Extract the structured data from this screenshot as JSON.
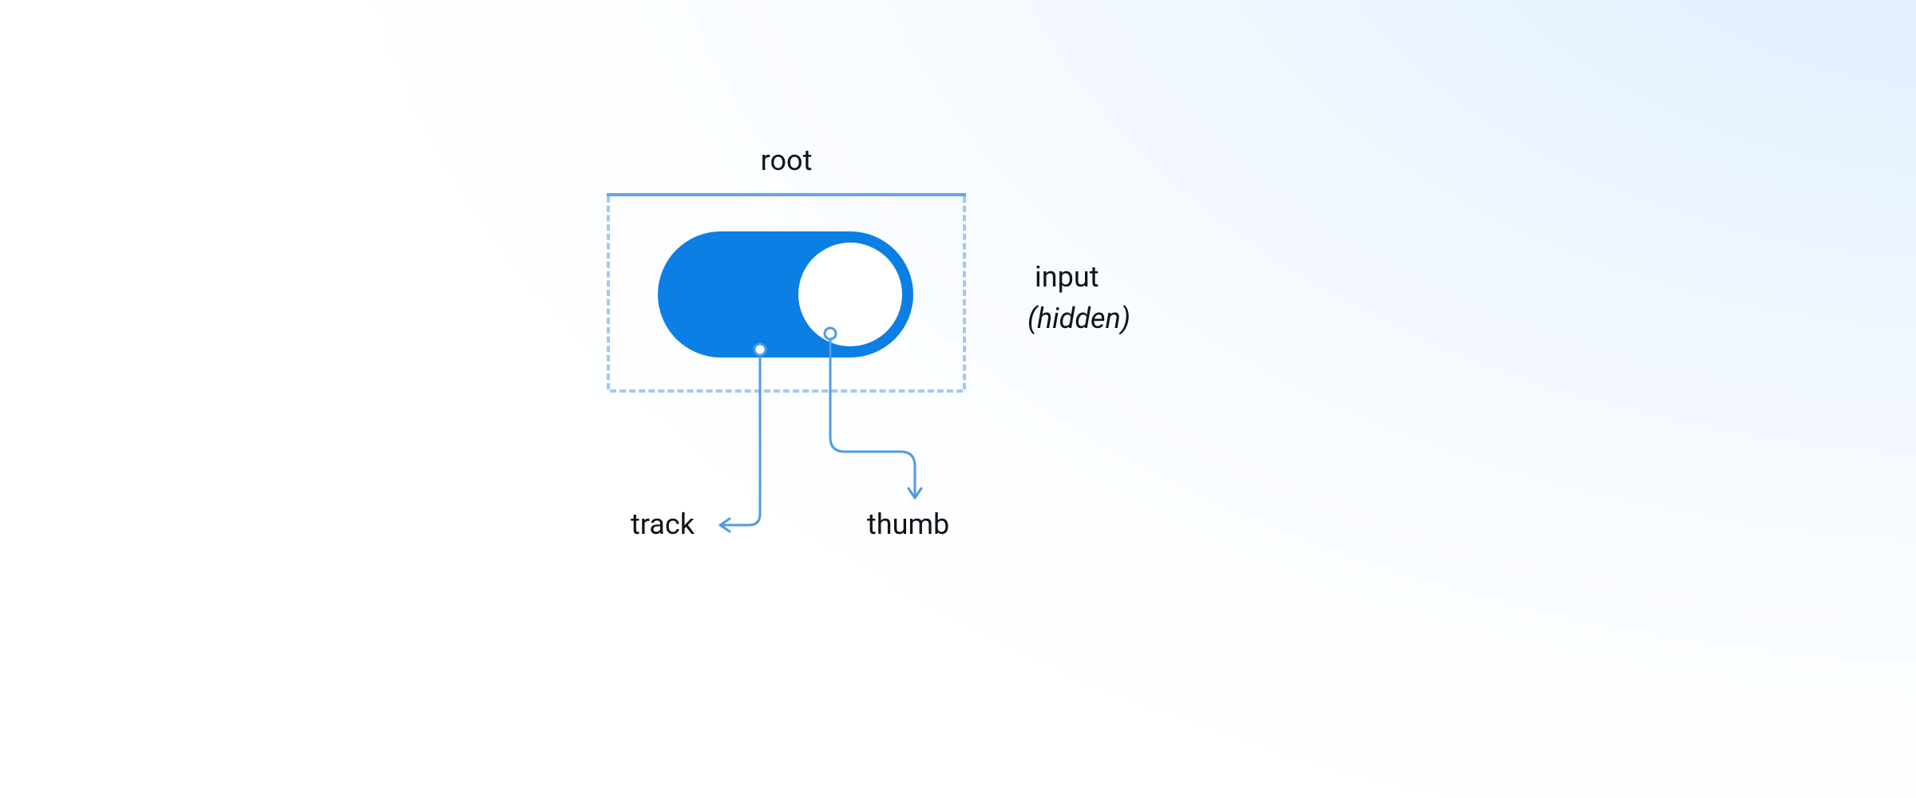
{
  "diagram": {
    "title": "root",
    "input_label": "input",
    "input_note": "(hidden)",
    "parts": {
      "track": "track",
      "thumb": "thumb"
    },
    "colors": {
      "track_fill": "#0b7fe3",
      "thumb_fill": "#ffffff",
      "outline_solid": "#62a6ec",
      "outline_dashed": "#a1c9f4",
      "connector": "#4f9ae8",
      "text": "#0f1419"
    },
    "switch_state": "on"
  }
}
